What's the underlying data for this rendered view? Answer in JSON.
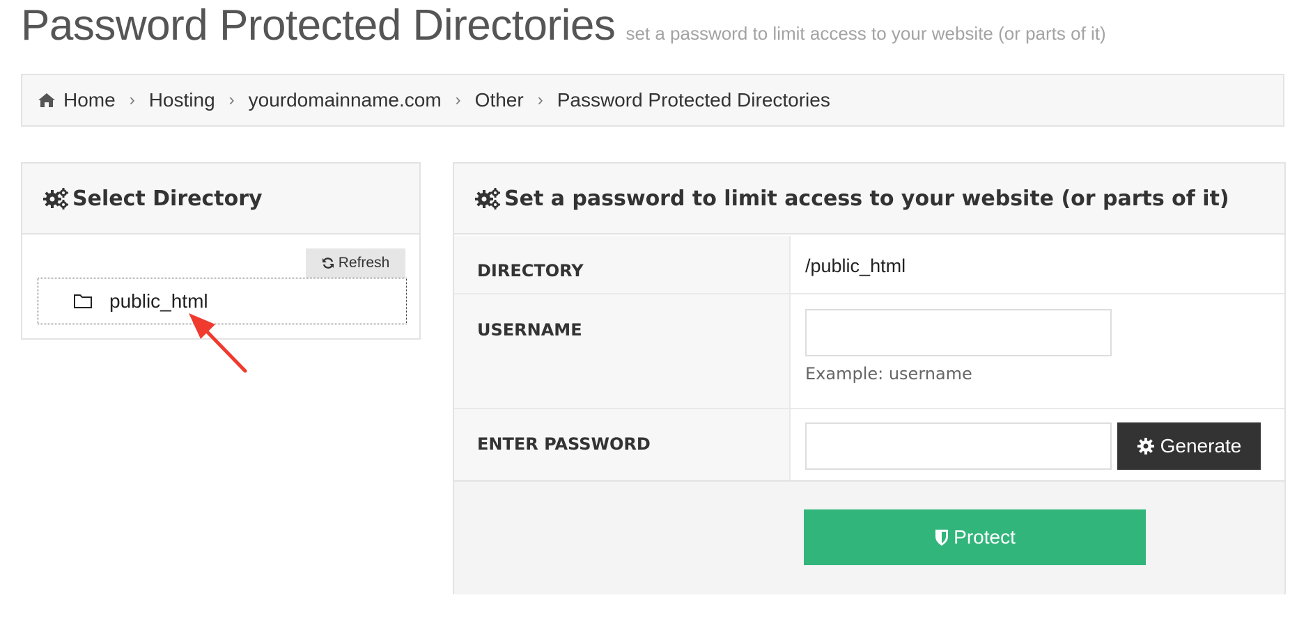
{
  "header": {
    "title": "Password Protected Directories",
    "subtitle": "set a password to limit access to your website (or parts of it)"
  },
  "breadcrumb": [
    {
      "label": "Home",
      "icon": "home-icon"
    },
    {
      "label": "Hosting"
    },
    {
      "label": "yourdomainname.com"
    },
    {
      "label": "Other"
    },
    {
      "label": "Password Protected Directories"
    }
  ],
  "select_directory": {
    "heading": "Select Directory",
    "icon": "gears-icon",
    "refresh_label": "Refresh",
    "tree": [
      {
        "name": "public_html",
        "icon": "folder-icon"
      }
    ]
  },
  "form": {
    "heading": "Set a password to limit access to your website (or parts of it)",
    "icon": "gears-icon",
    "directory_label": "DIRECTORY",
    "directory_value": "/public_html",
    "username_label": "USERNAME",
    "username_value": "",
    "username_help": "Example: username",
    "password_label": "ENTER PASSWORD",
    "password_value": "",
    "generate_label": "Generate",
    "protect_label": "Protect"
  },
  "colors": {
    "protect_button": "#31b57b",
    "generate_button": "#333333",
    "annotation_arrow": "#f03a2e"
  }
}
